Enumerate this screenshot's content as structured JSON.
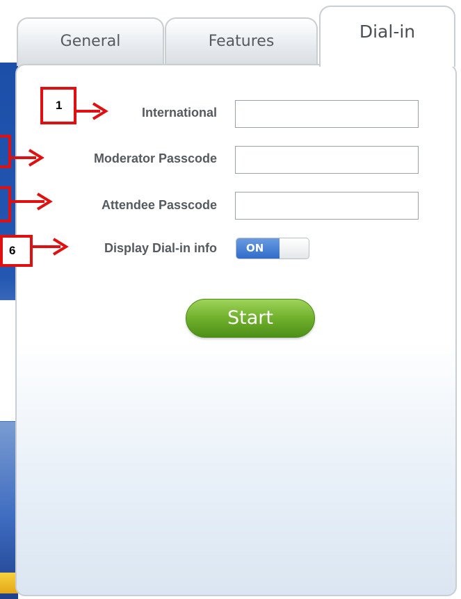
{
  "tabs": [
    {
      "label": "General",
      "active": false
    },
    {
      "label": "Features",
      "active": false
    },
    {
      "label": "Dial-in",
      "active": true
    }
  ],
  "form": {
    "fields": [
      {
        "label": "International",
        "value": ""
      },
      {
        "label": "Moderator Passcode",
        "value": ""
      },
      {
        "label": "Attendee Passcode",
        "value": ""
      }
    ],
    "toggle": {
      "label": "Display Dial-in info",
      "state": "ON"
    },
    "start_label": "Start"
  },
  "annotations": [
    "1",
    "6"
  ],
  "colors": {
    "annotation_red": "#e01010",
    "toggle_blue": "#2f6cc9",
    "start_green": "#6fb02c",
    "background_blue": "#2457b2"
  }
}
